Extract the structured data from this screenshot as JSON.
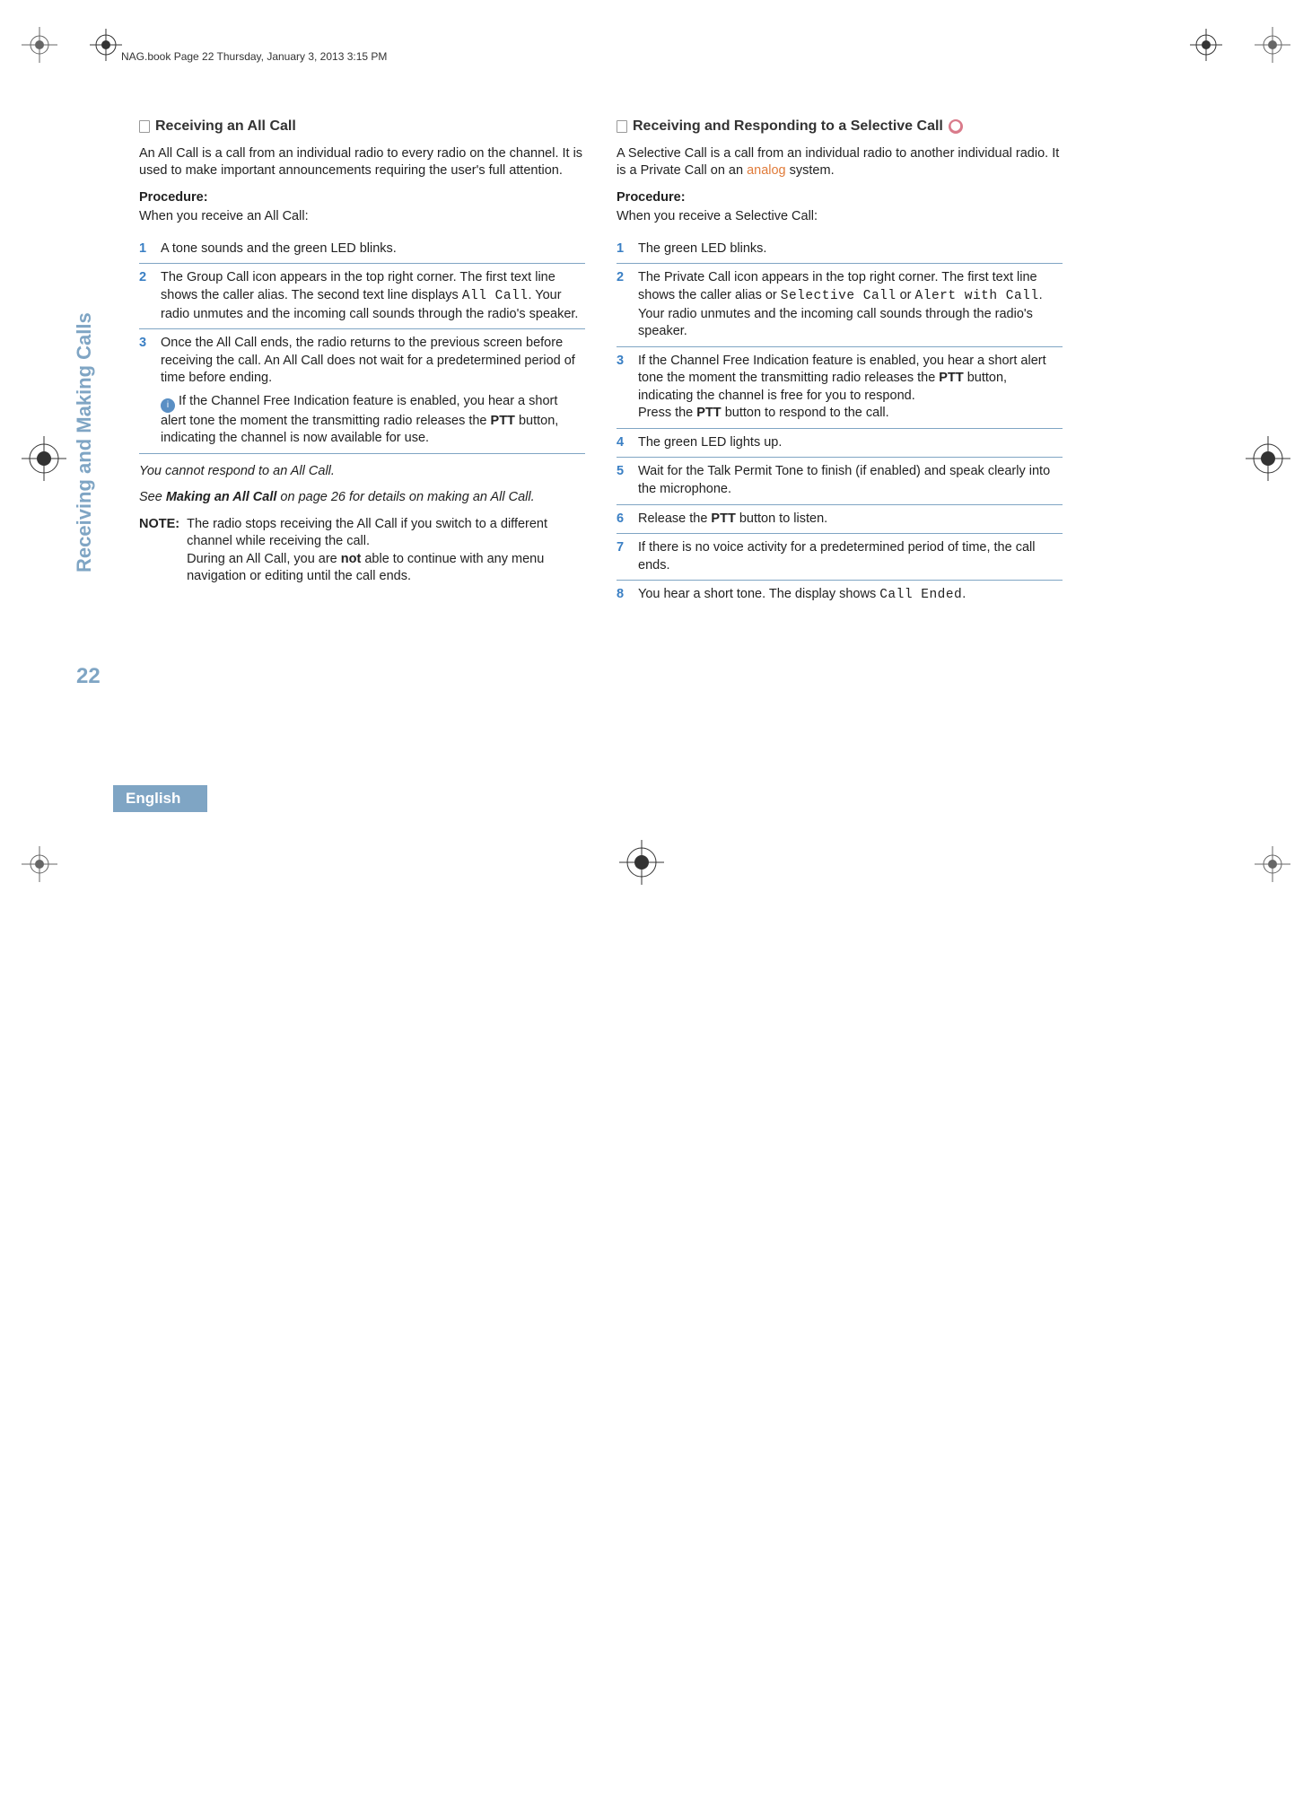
{
  "header": "NAG.book  Page 22  Thursday, January 3, 2013  3:15 PM",
  "sidebar": {
    "label": "Receiving and Making Calls",
    "page": "22",
    "language": "English"
  },
  "left": {
    "title": "Receiving an All Call",
    "intro": "An All Call is a call from an individual radio to every radio on the channel. It is used to make important announcements requiring the user's full attention.",
    "procLabel": "Procedure:",
    "procSub": "When you receive an All Call:",
    "steps": {
      "s1": "A tone sounds and the green LED blinks.",
      "s2a": "The Group Call icon appears in the top right corner. The first text line shows the caller alias. The second text line displays ",
      "s2code": "All Call",
      "s2b": ". Your radio unmutes and the incoming call sounds through the radio's speaker.",
      "s3a": "Once the All Call ends, the radio returns to the previous screen before receiving the call. An All Call does not wait for a predetermined period of time before ending.",
      "s3note_a": "If the Channel Free Indication feature is enabled, you hear a short alert tone the moment the transmitting radio releases the ",
      "s3note_ptt": "PTT",
      "s3note_b": " button, indicating the channel is now available for use."
    },
    "cannot": "You cannot respond to an All Call.",
    "see_a": "See ",
    "see_bold": "Making an All Call",
    "see_b": " on page 26 for details on making an All Call.",
    "noteLabel": "NOTE:",
    "noteText_a": "The radio stops receiving the All Call if you switch to a different channel while receiving the call.",
    "noteText_b": "During an All Call, you are ",
    "noteText_not": "not",
    "noteText_c": " able to continue with any menu navigation or editing until the call ends."
  },
  "right": {
    "title": "Receiving and Responding to a Selective Call",
    "intro_a": "A Selective Call is a call from an individual radio to another individual radio. It is a Private Call on an ",
    "intro_analog": "analog",
    "intro_b": " system.",
    "procLabel": "Procedure:",
    "procSub": "When you receive a Selective Call:",
    "steps": {
      "s1": "The green LED blinks.",
      "s2a": "The Private Call icon appears in the top right corner. The first text line shows the caller alias or ",
      "s2code1": "Selective Call",
      "s2mid": " or ",
      "s2code2": "Alert with Call",
      "s2b": ". Your radio unmutes and the incoming call sounds through the radio's speaker.",
      "s3a": "If the Channel Free Indication feature is enabled, you hear a short alert tone the moment the transmitting radio releases the ",
      "s3ptt": "PTT",
      "s3b": " button, indicating the channel is free for you to respond.",
      "s3c": "Press the ",
      "s3ptt2": "PTT",
      "s3d": " button to respond to the call.",
      "s4": "The green LED lights up.",
      "s5": "Wait for the Talk Permit Tone to finish (if enabled) and speak clearly into the microphone.",
      "s6a": "Release the ",
      "s6ptt": "PTT",
      "s6b": " button to listen.",
      "s7": "If there is no voice activity for a predetermined period of time, the call ends.",
      "s8a": "You hear a short tone. The display shows ",
      "s8code": "Call Ended",
      "s8b": "."
    }
  }
}
